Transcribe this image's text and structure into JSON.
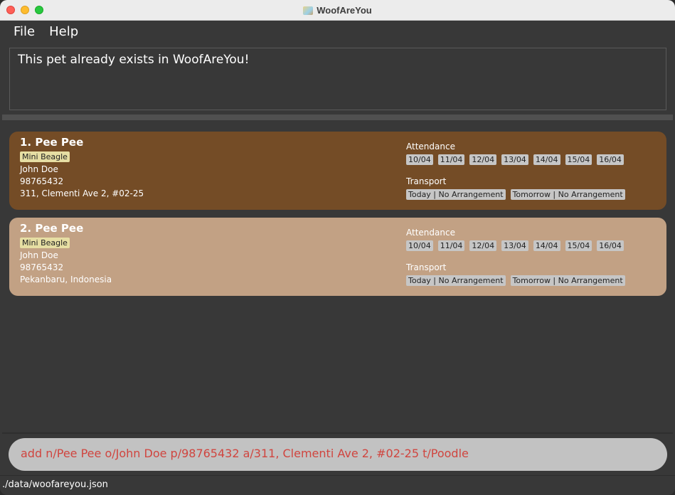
{
  "window": {
    "title": "WoofAreYou"
  },
  "menu": {
    "file": "File",
    "help": "Help"
  },
  "result": {
    "message": "This pet already exists in WoofAreYou!"
  },
  "pets": [
    {
      "index_name": "1.  Pee Pee",
      "breed": "Mini Beagle",
      "owner": "John Doe",
      "phone": "98765432",
      "address": "311, Clementi Ave 2, #02-25",
      "attendance_label": "Attendance",
      "attendance": [
        "10/04",
        "11/04",
        "12/04",
        "13/04",
        "14/04",
        "15/04",
        "16/04"
      ],
      "transport_label": "Transport",
      "transport": [
        "Today | No Arrangement",
        "Tomorrow | No Arrangement"
      ]
    },
    {
      "index_name": "2.  Pee Pee",
      "breed": "Mini Beagle",
      "owner": "John Doe",
      "phone": "98765432",
      "address": "Pekanbaru, Indonesia",
      "attendance_label": "Attendance",
      "attendance": [
        "10/04",
        "11/04",
        "12/04",
        "13/04",
        "14/04",
        "15/04",
        "16/04"
      ],
      "transport_label": "Transport",
      "transport": [
        "Today | No Arrangement",
        "Tomorrow | No Arrangement"
      ]
    }
  ],
  "command": {
    "value": "add n/Pee Pee o/John Doe p/98765432 a/311, Clementi Ave 2, #02-25 t/Poodle",
    "text_color": "#d0453f"
  },
  "status": {
    "file_path": "./data/woofareyou.json"
  },
  "colors": {
    "card_odd": "#744c26",
    "card_even": "#c2a184",
    "background": "#383838"
  }
}
